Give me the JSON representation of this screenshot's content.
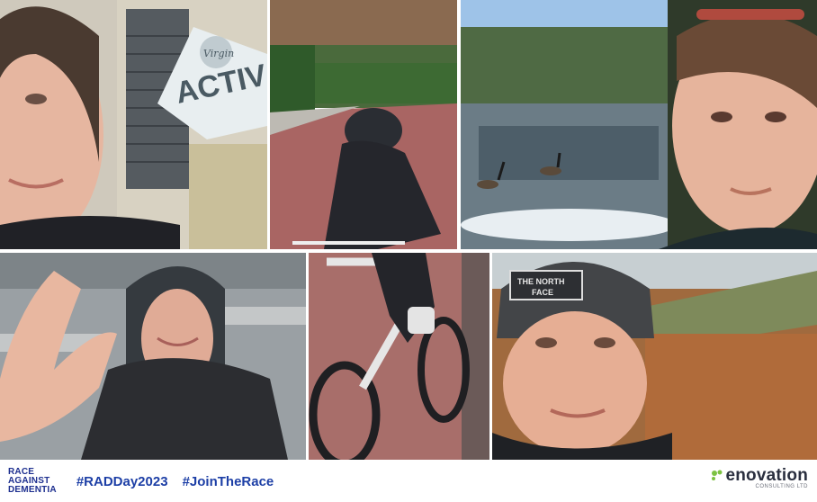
{
  "photos": [
    {
      "name": "selfie-gym-sign",
      "sign_text": "ACTIV",
      "sign_brand": "Virgin"
    },
    {
      "name": "cyclist-on-road"
    },
    {
      "name": "selfie-frozen-pond-geese"
    },
    {
      "name": "selfie-peace-sign-garage"
    },
    {
      "name": "cyclist-close-up"
    },
    {
      "name": "selfie-north-face-beanie",
      "beanie_text": "THE NORTH FACE"
    }
  ],
  "footer": {
    "rad_logo": [
      "RACE",
      "AGAINST",
      "DEMENTIA"
    ],
    "hashtags": [
      "#RADDay2023",
      "#JoinTheRace"
    ],
    "sponsor_name": "enovation",
    "sponsor_sub": "CONSULTING LTD"
  },
  "colors": {
    "brand_blue": "#1d3fa6",
    "sponsor_green": "#7cc242"
  }
}
